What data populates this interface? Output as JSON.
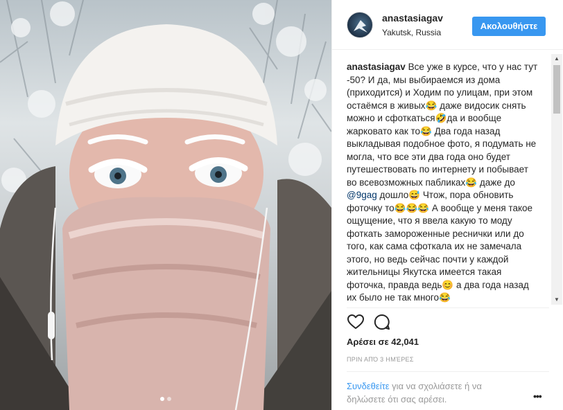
{
  "post": {
    "username": "anastasiagav",
    "location": "Yakutsk, Russia",
    "follow_label": "Ακολουθήστε",
    "caption_text": "Все уже в курсе, что у нас тут -50? И да, мы выбираемся из дома (приходится) и Ходим по улицам, при этом остаёмся в живых😂 даже видосик снять можно и сфоткаться🤣да и вообще жарковато как то😂 Два года назад выкладывая подобное фото, я подумать не могла, что все эти два года оно будет путешествовать по интернету и побывает во всевозможных пабликах😂 даже до ",
    "caption_tag": "@9gag",
    "caption_text2": " дошло😅 Чтож, пора обновить фоточку то😂😂😂 А вообще у меня такое ощущение, что я ввела какую то моду фоткать замороженные реснички или до того, как сама сфоткала их не замечала этого, но ведь сейчас почти у каждой жительницы Якутска имеется такая фоточка, правда ведь😊 а два года назад их было не так много😂",
    "likes_text": "Αρέσει σε 42,041",
    "time_text": "ΠΡΙΝ ΑΠΌ 3 ΗΜΈΡΕΣ",
    "comment_link": "Συνδεθείτε",
    "comment_rest": " για να σχολιάσετε ή να δηλώσετε ότι σας αρέσει.",
    "more_label": "•••"
  },
  "icons": {
    "heart": "heart-icon",
    "comment": "comment-icon",
    "more": "more-options-icon"
  },
  "colors": {
    "accent": "#3897f0",
    "text": "#262626",
    "muted": "#999999"
  },
  "carousel": {
    "total": 2,
    "active": 1
  }
}
